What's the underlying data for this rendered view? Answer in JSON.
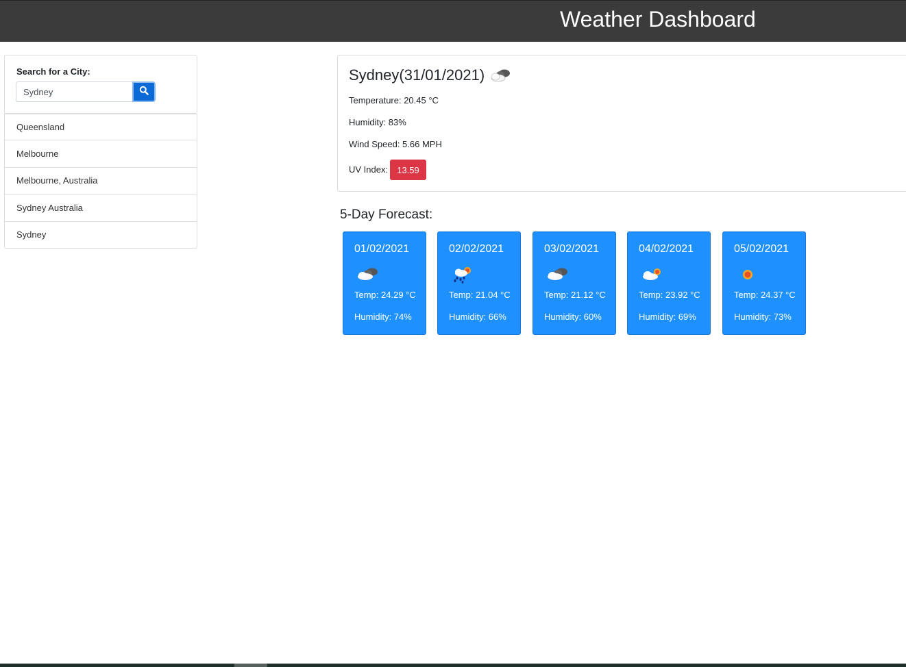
{
  "header": {
    "title": "Weather Dashboard"
  },
  "search": {
    "label": "Search for a City:",
    "value": "Sydney",
    "button_icon": "search-icon"
  },
  "history": {
    "items": [
      {
        "label": "Queensland"
      },
      {
        "label": "Melbourne"
      },
      {
        "label": "Melbourne, Australia"
      },
      {
        "label": "Sydney Australia"
      },
      {
        "label": "Sydney"
      }
    ]
  },
  "current": {
    "title": "Sydney(31/01/2021)",
    "icon": "cloudy-icon",
    "temperature": "Temperature: 20.45 °C",
    "humidity": "Humidity: 83%",
    "wind": "Wind Speed: 5.66 MPH",
    "uv_label": "UV Index:",
    "uv_value": "13.59",
    "uv_color": "#dc3545"
  },
  "forecast": {
    "heading": "5-Day Forecast:",
    "card_color": "#1e90ff",
    "days": [
      {
        "date": "01/02/2021",
        "icon": "cloudy-icon",
        "temp": "Temp: 24.29 °C",
        "humidity": "Humidity: 74%"
      },
      {
        "date": "02/02/2021",
        "icon": "rain-sun-icon",
        "temp": "Temp: 21.04 °C",
        "humidity": "Humidity: 66%"
      },
      {
        "date": "03/02/2021",
        "icon": "cloudy-icon",
        "temp": "Temp: 21.12 °C",
        "humidity": "Humidity: 60%"
      },
      {
        "date": "04/02/2021",
        "icon": "partly-sunny-icon",
        "temp": "Temp: 23.92 °C",
        "humidity": "Humidity: 69%"
      },
      {
        "date": "05/02/2021",
        "icon": "sun-icon",
        "temp": "Temp: 24.37 °C",
        "humidity": "Humidity: 73%"
      }
    ]
  }
}
